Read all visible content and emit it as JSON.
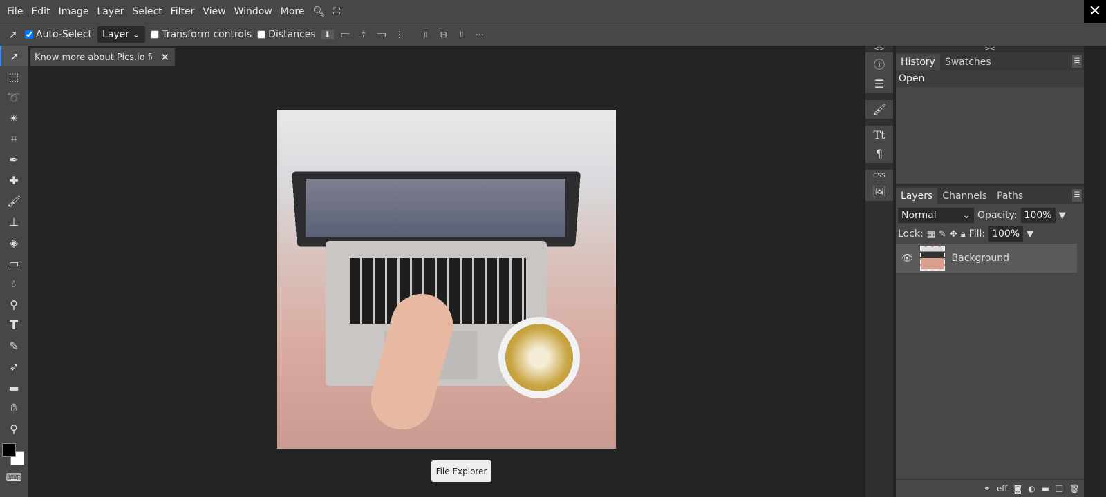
{
  "menu": [
    "File",
    "Edit",
    "Image",
    "Layer",
    "Select",
    "Filter",
    "View",
    "Window",
    "More"
  ],
  "options": {
    "auto_select": "Auto-Select",
    "auto_select_checked": true,
    "target": "Layer",
    "transform_controls": "Transform controls",
    "distances": "Distances"
  },
  "document_tab": {
    "title": "Know more about Pics.io fo",
    "close": "✕"
  },
  "file_explorer": "File Explorer",
  "history": {
    "tabs": [
      "History",
      "Swatches"
    ],
    "items": [
      "Open"
    ]
  },
  "layers": {
    "tabs": [
      "Layers",
      "Channels",
      "Paths"
    ],
    "blend_mode": "Normal",
    "opacity_label": "Opacity:",
    "opacity": "100%",
    "lock_label": "Lock:",
    "fill_label": "Fill:",
    "fill": "100%",
    "items": [
      {
        "name": "Background",
        "visible": true
      }
    ]
  },
  "icon_column": {
    "css": "CSS"
  },
  "colors": {
    "foreground": "#000000",
    "background": "#ffffff",
    "accent": "#3d8ee8"
  }
}
